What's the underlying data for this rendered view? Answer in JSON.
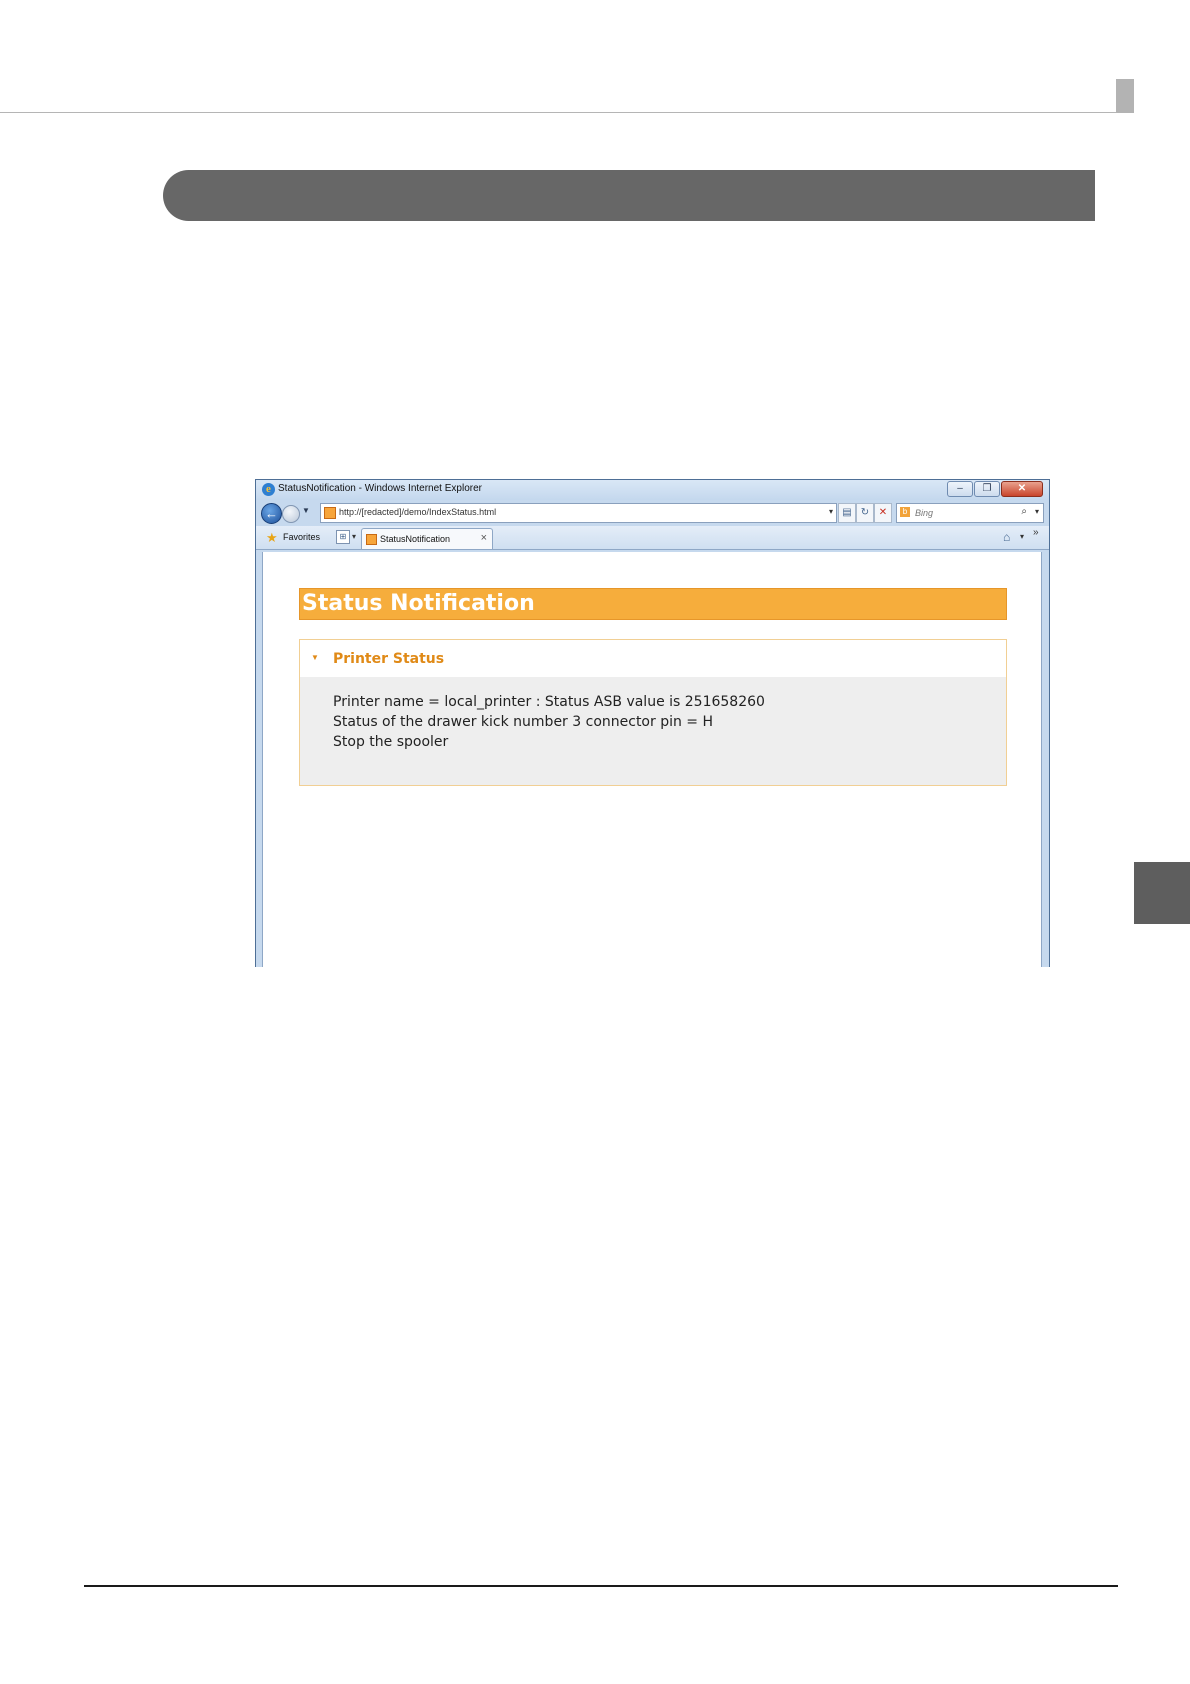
{
  "browser": {
    "window_title": "StatusNotification - Windows Internet Explorer",
    "address": "http://[redacted]/demo/IndexStatus.html",
    "search_placeholder": "Bing",
    "favorites_label": "Favorites",
    "tab_label": "StatusNotification",
    "minimize_glyph": "–",
    "restore_glyph": "❐",
    "close_glyph": "✕",
    "chevron_glyph": "»"
  },
  "page": {
    "header_title": "Status Notification",
    "panel": {
      "title": "Printer Status",
      "lines": [
        "Printer name = local_printer : Status ASB value is 251658260",
        "Status of the drawer kick number 3 connector pin = H",
        "Stop the spooler"
      ]
    }
  },
  "icons": {
    "ie_logo": "internet-explorer-icon",
    "back": "back-arrow-icon",
    "forward": "forward-arrow-icon",
    "star": "favorites-star-icon",
    "home": "home-icon",
    "search": "search-icon"
  },
  "colors": {
    "accent_orange": "#f6ad3c",
    "panel_title": "#e08a17",
    "section_bar": "#676767"
  }
}
